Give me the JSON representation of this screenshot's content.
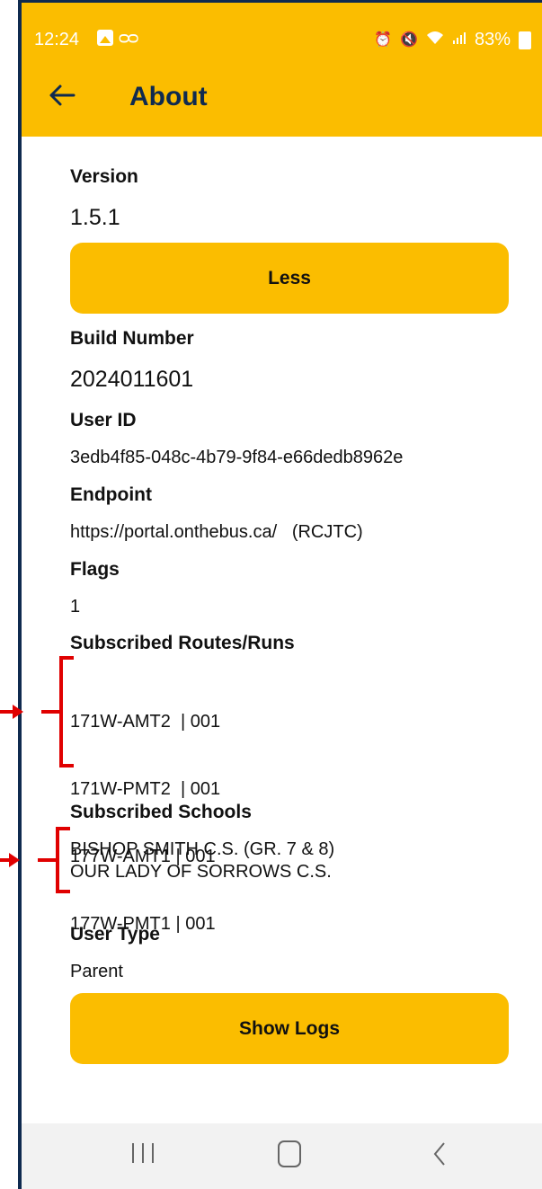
{
  "status_bar": {
    "time": "12:24",
    "battery": "83%",
    "voicemail_glyph": "ᴑᴑ",
    "icons": [
      "image-icon",
      "voicemail-icon",
      "alarm-icon",
      "mute-icon",
      "wifi-icon",
      "signal-icon",
      "battery-icon"
    ]
  },
  "app_bar": {
    "title": "About",
    "back_icon": "arrow-left-icon"
  },
  "about": {
    "version_label": "Version",
    "version_value": "1.5.1",
    "less_button": "Less",
    "build_label": "Build Number",
    "build_value": "2024011601",
    "user_id_label": "User ID",
    "user_id_value": "3edb4f85-048c-4b79-9f84-e66dedb8962e",
    "endpoint_label": "Endpoint",
    "endpoint_value": "https://portal.onthebus.ca/   (RCJTC)",
    "flags_label": "Flags",
    "flags_value": "1",
    "routes_label": "Subscribed Routes/Runs",
    "routes": [
      "171W-AMT2  | 001",
      "171W-PMT2  | 001",
      "177W-AMT1 | 001",
      "177W-PMT1 | 001"
    ],
    "schools_label": "Subscribed Schools",
    "schools": [
      "BISHOP SMITH C.S. (GR. 7 & 8)",
      "OUR LADY OF SORROWS C.S."
    ],
    "user_type_label": "User Type",
    "user_type_value": "Parent",
    "show_logs_button": "Show Logs"
  },
  "nav_bar": {
    "icons": [
      "recent-apps-icon",
      "home-icon",
      "back-icon"
    ]
  },
  "colors": {
    "accent": "#fbbd00",
    "title": "#0f2a4f",
    "annotation": "#e00000"
  }
}
